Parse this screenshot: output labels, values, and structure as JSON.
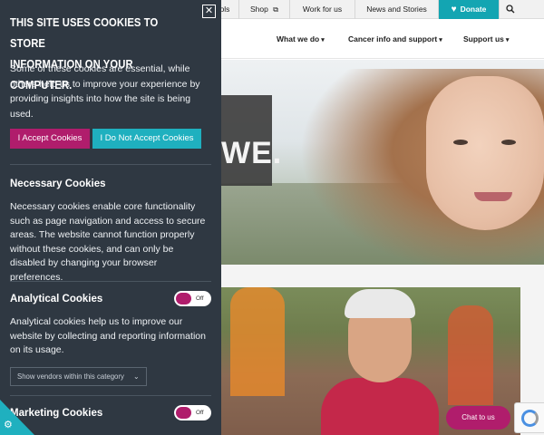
{
  "site": {
    "topbar": {
      "items": [
        "ols",
        "Shop",
        "Work for us",
        "News and Stories",
        "Donate"
      ],
      "shop_icon": "external-link-icon",
      "donate_icon": "heart-icon",
      "search_icon": "search-icon"
    },
    "nav": {
      "items": [
        "What we do",
        "Cancer info and support",
        "Support us"
      ],
      "caret": "▾"
    },
    "hero": {
      "tagline_fragment": "WE."
    },
    "chat_label": "Chat to us"
  },
  "cookie_panel": {
    "title_line1": "THIS SITE USES COOKIES TO STORE",
    "title_line2": "INFORMATION ON YOUR COMPUTER.",
    "intro": "Some of these cookies are essential, while others help us to improve your experience by providing insights into how the site is being used.",
    "accept_label": "I Accept Cookies",
    "reject_label": "I Do Not Accept Cookies",
    "sections": [
      {
        "title": "Necessary Cookies",
        "body": "Necessary cookies enable core functionality such as page navigation and access to secure areas. The website cannot function properly without these cookies, and can only be disabled by changing your browser preferences."
      },
      {
        "title": "Analytical Cookies",
        "toggle_label": "Off",
        "body": "Analytical cookies help us to improve our website by collecting and reporting information on its usage.",
        "vendors_label": "Show vendors within this category"
      },
      {
        "title": "Marketing Cookies",
        "toggle_label": "Off"
      }
    ]
  },
  "colors": {
    "panel_bg": "#2f3842",
    "accent_pink": "#b01d6c",
    "accent_teal": "#1fb0bf"
  }
}
